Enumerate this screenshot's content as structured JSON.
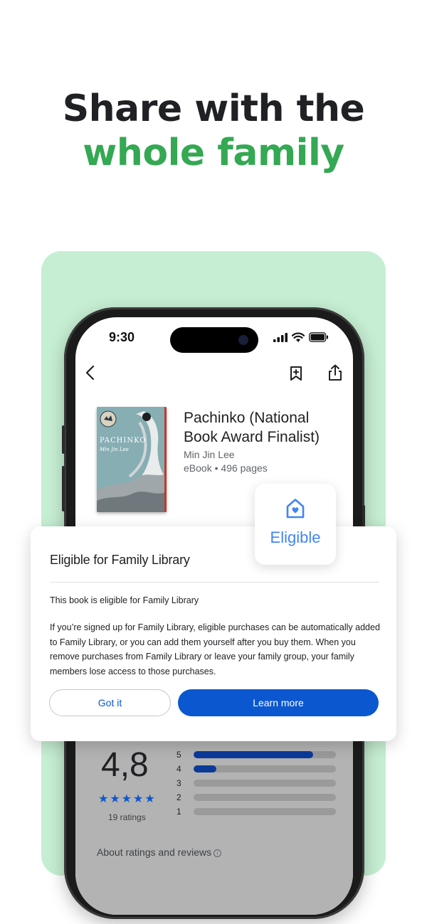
{
  "headline": {
    "line1": "Share with the",
    "line2": "whole family"
  },
  "status_bar": {
    "time": "9:30"
  },
  "book": {
    "cover_title": "PACHINKO",
    "cover_author": "Min Jin Lee",
    "title": "Pachinko (National Book Award Finalist)",
    "author": "Min Jin Lee",
    "meta": "eBook • 496 pages"
  },
  "ratings": {
    "average": "4,8",
    "stars": 5,
    "count": "19 ratings",
    "about_link": "About ratings and reviews",
    "distribution": [
      {
        "label": "5",
        "fraction": 0.84
      },
      {
        "label": "4",
        "fraction": 0.16
      },
      {
        "label": "3",
        "fraction": 0
      },
      {
        "label": "2",
        "fraction": 0
      },
      {
        "label": "1",
        "fraction": 0
      }
    ]
  },
  "badge": {
    "label": "Eligible",
    "icon": "home-heart-icon"
  },
  "dialog": {
    "title": "Eligible for Family Library",
    "subtitle": "This book is eligible for Family Library",
    "body": "If you’re signed up for Family Library, eligible purchases can be automatically added to Family Library, or you can add them yourself after you buy them. When you remove purchases from Family Library or leave your family group, your family members lose access to those purchases.",
    "secondary_button": "Got it",
    "primary_button": "Learn more"
  },
  "colors": {
    "accent_green": "#34a853",
    "mint_background": "#c6eed3",
    "primary_blue": "#0b57d0",
    "badge_blue": "#4285f4"
  }
}
